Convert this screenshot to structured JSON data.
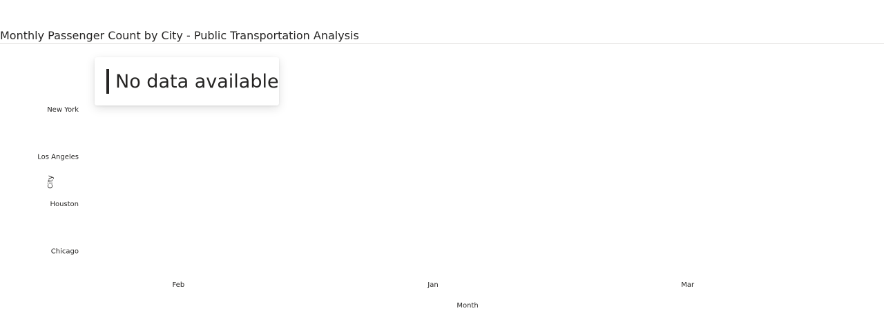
{
  "chart_data": {
    "type": "heatmap",
    "title": "Monthly Passenger Count by City - Public Transportation Analysis",
    "xlabel": "Month",
    "ylabel": "City",
    "x_categories": [
      "Feb",
      "Jan",
      "Mar"
    ],
    "y_categories": [
      "New York",
      "Los Angeles",
      "Houston",
      "Chicago"
    ],
    "values": [],
    "empty_message": "No data available",
    "grid": false,
    "legend": "none"
  },
  "colors": {
    "text": "#252423",
    "rule": "#e1dfdd",
    "background": "#ffffff"
  }
}
